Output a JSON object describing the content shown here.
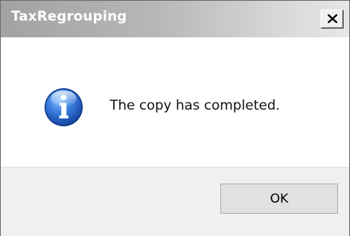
{
  "window": {
    "title": "TaxRegrouping",
    "close_icon": "close-icon"
  },
  "dialog": {
    "icon": "info-icon",
    "message": "The copy has completed."
  },
  "buttons": {
    "ok_label": "OK"
  },
  "colors": {
    "titlebar_gradient_start": "#a2a2a2",
    "titlebar_gradient_end": "#e6e6e6",
    "footer_background": "#f0f0f0",
    "icon_blue": "#1c5fc6"
  }
}
